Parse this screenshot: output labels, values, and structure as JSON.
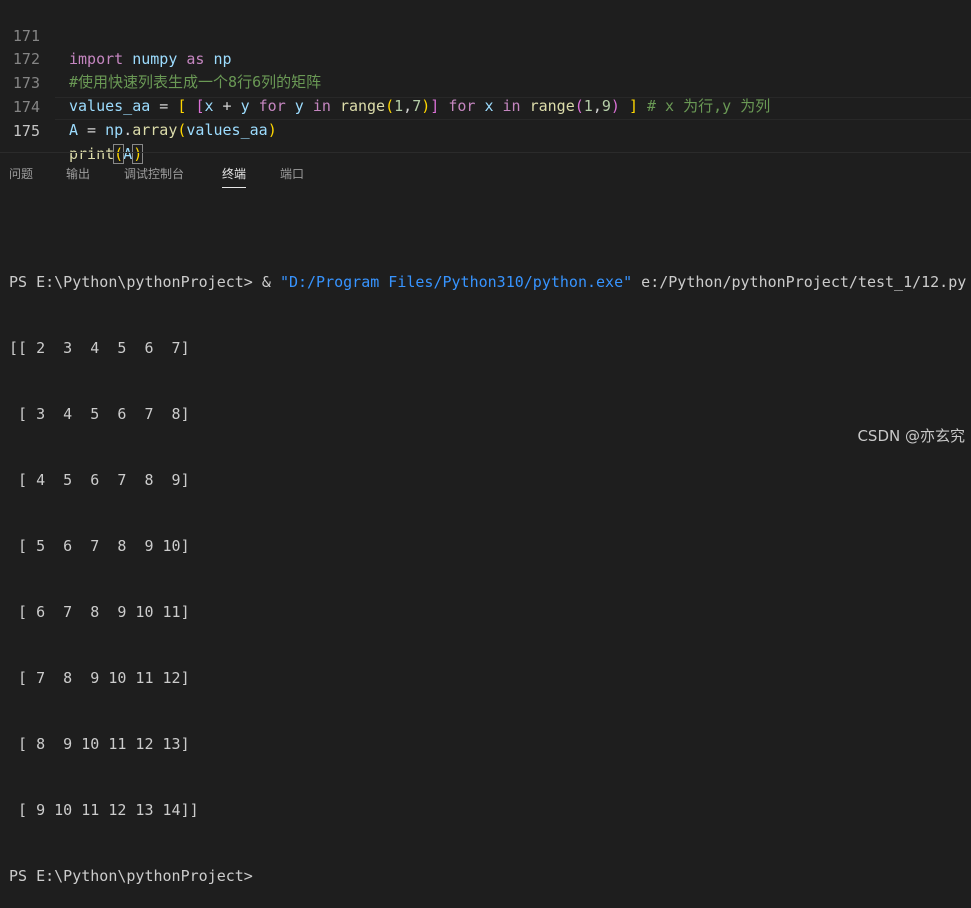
{
  "editor": {
    "line_numbers": [
      "171",
      "172",
      "173",
      "174",
      "175"
    ],
    "active_line": "175",
    "line_171": {
      "kw_import": "import",
      "mod": " numpy ",
      "kw_as": "as",
      "alias": " np"
    },
    "line_172": {
      "comment": "#使用快速列表生成一个8行6列的矩阵"
    },
    "line_173": {
      "var": "values_aa",
      "eq": " = ",
      "ob1": "[",
      "sp1": " ",
      "ob2": "[",
      "x1": "x",
      "plus": " + ",
      "y1": "y",
      "sp2": " ",
      "for1": "for",
      "sp3": " ",
      "y2": "y",
      "sp4": " ",
      "in1": "in",
      "sp5": " ",
      "range1": "range",
      "p1o": "(",
      "n1": "1",
      "c1": ",",
      "n7": "7",
      "p1c": ")",
      "cb2": "]",
      "sp6": " ",
      "for2": "for",
      "sp7": " ",
      "x2": "x",
      "sp8": " ",
      "in2": "in",
      "sp9": " ",
      "range2": "range",
      "p2o": "(",
      "n1b": "1",
      "c2": ",",
      "n9": "9",
      "p2c": ")",
      "sp10": " ",
      "cb1": "]",
      "sp11": " ",
      "comment": "# x 为行,y 为列"
    },
    "line_174": {
      "var": "A",
      "eq": " = ",
      "mod": "np",
      "dot": ".",
      "fn": "array",
      "po": "(",
      "arg": "values_aa",
      "pc": ")"
    },
    "line_175": {
      "fn": "print",
      "po": "(",
      "arg": "A",
      "pc": ")"
    }
  },
  "panel": {
    "tabs": [
      "问题",
      "输出",
      "调试控制台",
      "终端",
      "端口"
    ],
    "active_tab": "终端"
  },
  "terminal": {
    "command_prefix": "PS E:\\Python\\pythonProject> & ",
    "command_exe": "\"D:/Program Files/Python310/python.exe\"",
    "command_script": " e:/Python/pythonProject/test_1/12.py",
    "output_lines": [
      "[[ 2  3  4  5  6  7]",
      " [ 3  4  5  6  7  8]",
      " [ 4  5  6  7  8  9]",
      " [ 5  6  7  8  9 10]",
      " [ 6  7  8  9 10 11]",
      " [ 7  8  9 10 11 12]",
      " [ 8  9 10 11 12 13]",
      " [ 9 10 11 12 13 14]]"
    ],
    "prompt": "PS E:\\Python\\pythonProject>"
  },
  "watermark": "CSDN @亦玄究",
  "colors": {
    "background": "#1e1e1e",
    "keyword": "#c586c0",
    "comment": "#6a9955",
    "variable": "#9cdcfe",
    "function": "#dcdcaa",
    "number": "#b5cea8",
    "string_link": "#3794ff"
  }
}
